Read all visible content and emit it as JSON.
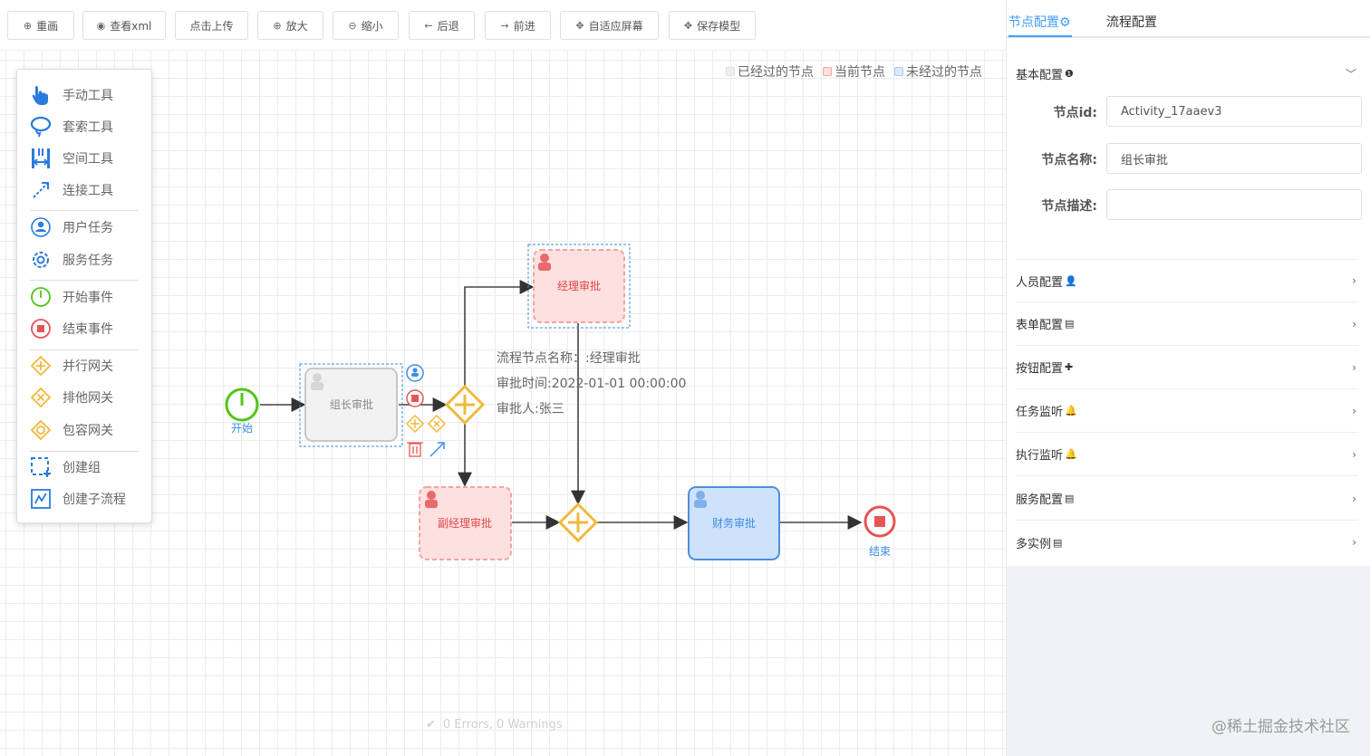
{
  "toolbar": {
    "buttons": [
      {
        "icon": "plus-circle-icon",
        "label": "重画"
      },
      {
        "icon": "eye-icon",
        "label": "查看xml"
      },
      {
        "icon": "",
        "label": "点击上传"
      },
      {
        "icon": "zoom-in-icon",
        "label": "放大"
      },
      {
        "icon": "zoom-out-icon",
        "label": "缩小"
      },
      {
        "icon": "arrow-left-icon",
        "label": "后退"
      },
      {
        "icon": "arrow-right-icon",
        "label": "前进"
      },
      {
        "icon": "move-icon",
        "label": "自适应屏幕"
      },
      {
        "icon": "move-icon",
        "label": "保存模型"
      }
    ]
  },
  "legend": {
    "passed": "已经过的节点",
    "current": "当前节点",
    "pending": "未经过的节点",
    "colors": {
      "passed": "#e8e8e8",
      "current": "#f4a3a3",
      "pending": "#a8c8f0"
    }
  },
  "palette": {
    "items": [
      {
        "icon": "hand-tool-icon",
        "label": "手动工具"
      },
      {
        "icon": "lasso-tool-icon",
        "label": "套索工具"
      },
      {
        "icon": "space-tool-icon",
        "label": "空间工具"
      },
      {
        "icon": "connect-tool-icon",
        "label": "连接工具"
      },
      {
        "icon": "user-task-icon",
        "label": "用户任务"
      },
      {
        "icon": "service-task-icon",
        "label": "服务任务"
      },
      {
        "icon": "start-event-icon",
        "label": "开始事件"
      },
      {
        "icon": "end-event-icon",
        "label": "结束事件"
      },
      {
        "icon": "parallel-gateway-icon",
        "label": "并行网关"
      },
      {
        "icon": "exclusive-gateway-icon",
        "label": "排他网关"
      },
      {
        "icon": "inclusive-gateway-icon",
        "label": "包容网关"
      },
      {
        "icon": "create-group-icon",
        "label": "创建组"
      },
      {
        "icon": "create-subprocess-icon",
        "label": "创建子流程"
      }
    ]
  },
  "diagram": {
    "start_label": "开始",
    "end_label": "结束",
    "task_group_leader": "组长审批",
    "task_manager": "经理审批",
    "task_deputy_manager": "副经理审批",
    "task_finance": "财务审批",
    "colors": {
      "passed": "#e8e8e8",
      "current": "#f4a3a3",
      "current_fill": "#fde0e0",
      "pending_fill": "#cfe2fb",
      "pending_stroke": "#4a90e2",
      "gateway": "#f0b93a",
      "start": "#52c41a",
      "end": "#e85454"
    }
  },
  "tooltip": {
    "line1": "流程节点名称：:经理审批",
    "line2": "审批时间:2022-01-01 00:00:00",
    "line3": "审批人:张三"
  },
  "status": {
    "text": "0 Errors, 0 Warnings"
  },
  "panel": {
    "tab_node": "节点配置",
    "tab_process": "流程配置",
    "basic_section": "基本配置",
    "field_id_label": "节点id:",
    "field_id_value": "Activity_17aaev3",
    "field_name_label": "节点名称:",
    "field_name_value": "组长审批",
    "field_desc_label": "节点描述:",
    "field_desc_value": "",
    "sections": [
      {
        "label": "人员配置",
        "icon": "user-icon"
      },
      {
        "label": "表单配置",
        "icon": "form-icon"
      },
      {
        "label": "按钮配置",
        "icon": "button-config-icon"
      },
      {
        "label": "任务监听",
        "icon": "bell-icon"
      },
      {
        "label": "执行监听",
        "icon": "bell-icon"
      },
      {
        "label": "服务配置",
        "icon": "service-config-icon"
      },
      {
        "label": "多实例",
        "icon": "multi-instance-icon"
      }
    ]
  },
  "watermark": "@稀土掘金技术社区"
}
